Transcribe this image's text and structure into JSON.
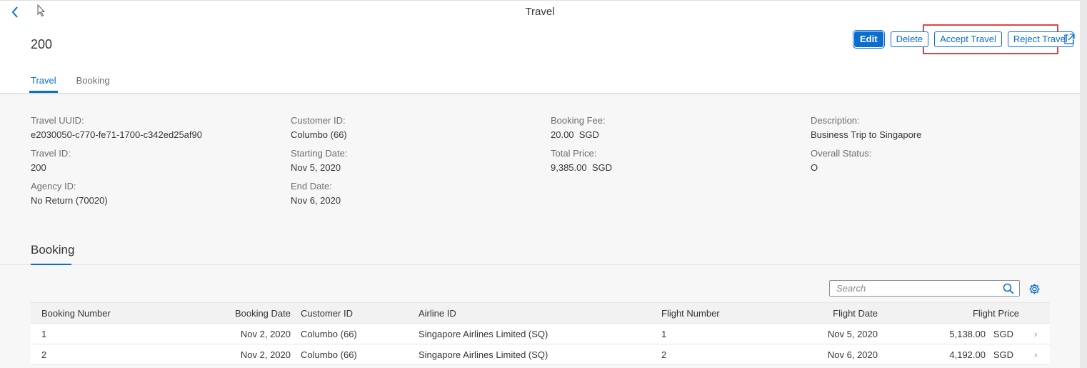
{
  "app": {
    "title": "Travel"
  },
  "header": {
    "title": "200",
    "actions": {
      "edit": "Edit",
      "delete": "Delete",
      "accept": "Accept Travel",
      "reject": "Reject Travel"
    }
  },
  "tabs": [
    {
      "label": "Travel",
      "active": true
    },
    {
      "label": "Booking",
      "active": false
    }
  ],
  "fields": {
    "travel_uuid": {
      "label": "Travel UUID:",
      "value": "e2030050-c770-fe71-1700-c342ed25af90"
    },
    "travel_id": {
      "label": "Travel ID:",
      "value": "200"
    },
    "agency_id": {
      "label": "Agency ID:",
      "value": "No Return (70020)"
    },
    "customer_id": {
      "label": "Customer ID:",
      "value": "Columbo (66)"
    },
    "starting_date": {
      "label": "Starting Date:",
      "value": "Nov 5, 2020"
    },
    "end_date": {
      "label": "End Date:",
      "value": "Nov 6, 2020"
    },
    "booking_fee": {
      "label": "Booking Fee:",
      "value": "20.00  SGD"
    },
    "total_price": {
      "label": "Total Price:",
      "value": "9,385.00  SGD"
    },
    "description": {
      "label": "Description:",
      "value": "Business Trip to Singapore"
    },
    "overall_status": {
      "label": "Overall Status:",
      "value": "O"
    }
  },
  "booking_section": {
    "title": "Booking",
    "search_placeholder": "Search",
    "columns": {
      "booking_number": "Booking Number",
      "booking_date": "Booking Date",
      "customer_id": "Customer ID",
      "airline_id": "Airline ID",
      "flight_number": "Flight Number",
      "flight_date": "Flight Date",
      "flight_price": "Flight Price"
    },
    "rows": [
      {
        "booking_number": "1",
        "booking_date": "Nov 2, 2020",
        "customer_id": "Columbo (66)",
        "airline_id": "Singapore Airlines Limited (SQ)",
        "flight_number": "1",
        "flight_date": "Nov 5, 2020",
        "flight_price": "5,138.00   SGD"
      },
      {
        "booking_number": "2",
        "booking_date": "Nov 2, 2020",
        "customer_id": "Columbo (66)",
        "airline_id": "Singapore Airlines Limited (SQ)",
        "flight_number": "2",
        "flight_date": "Nov 6, 2020",
        "flight_price": "4,192.00   SGD"
      }
    ]
  },
  "icons": {
    "back": "chevron-left-icon",
    "share": "share-icon",
    "search": "search-icon",
    "settings": "gear-icon",
    "row_nav": "chevron-right-icon"
  },
  "colors": {
    "accent": "#0a6ed1",
    "highlight": "#e04545"
  }
}
